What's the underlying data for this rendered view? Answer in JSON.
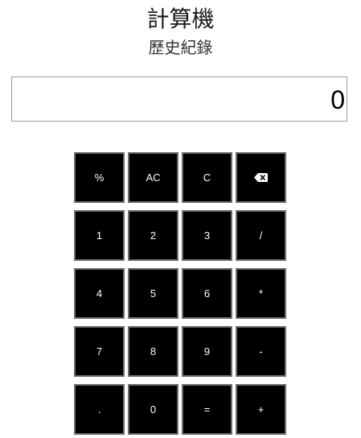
{
  "header": {
    "title": "計算機",
    "history_label": "歷史紀錄"
  },
  "display": {
    "value": "0"
  },
  "keypad": {
    "rows": [
      [
        {
          "label": "%",
          "name": "percent-button"
        },
        {
          "label": "AC",
          "name": "all-clear-button"
        },
        {
          "label": "C",
          "name": "clear-button"
        },
        {
          "label": "",
          "name": "backspace-button",
          "icon": "backspace-icon"
        }
      ],
      [
        {
          "label": "1",
          "name": "digit-1-button"
        },
        {
          "label": "2",
          "name": "digit-2-button"
        },
        {
          "label": "3",
          "name": "digit-3-button"
        },
        {
          "label": "/",
          "name": "divide-button"
        }
      ],
      [
        {
          "label": "4",
          "name": "digit-4-button"
        },
        {
          "label": "5",
          "name": "digit-5-button"
        },
        {
          "label": "6",
          "name": "digit-6-button"
        },
        {
          "label": "*",
          "name": "multiply-button"
        }
      ],
      [
        {
          "label": "7",
          "name": "digit-7-button"
        },
        {
          "label": "8",
          "name": "digit-8-button"
        },
        {
          "label": "9",
          "name": "digit-9-button"
        },
        {
          "label": "-",
          "name": "subtract-button"
        }
      ],
      [
        {
          "label": ".",
          "name": "decimal-button"
        },
        {
          "label": "0",
          "name": "digit-0-button"
        },
        {
          "label": "=",
          "name": "equals-button"
        },
        {
          "label": "+",
          "name": "add-button"
        }
      ]
    ]
  },
  "colors": {
    "key_background": "#000000",
    "key_border": "#6e6e6e",
    "key_text": "#ffffff",
    "display_border": "#9a9a9a"
  }
}
